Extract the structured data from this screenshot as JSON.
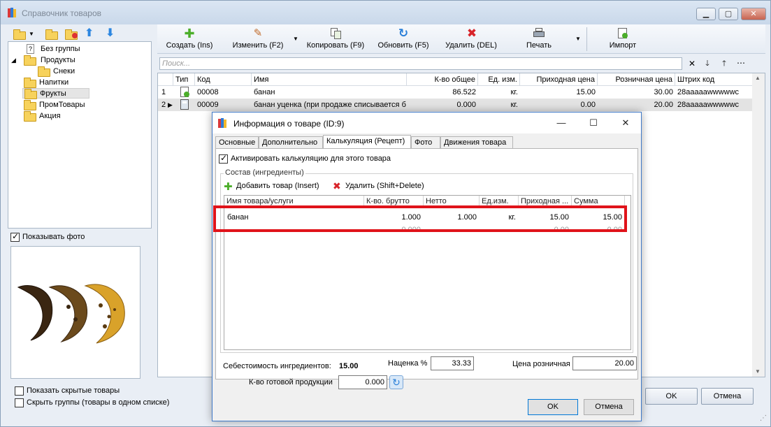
{
  "main_window": {
    "title": "Справочник товаров",
    "controls": [
      "▭",
      "▢",
      "✕"
    ]
  },
  "tree": {
    "items": [
      {
        "label": "Без группы",
        "level": 1
      },
      {
        "label": "Продукты",
        "level": 1
      },
      {
        "label": "Снеки",
        "level": 2
      },
      {
        "label": "Напитки",
        "level": 1
      },
      {
        "label": "Фрукты",
        "level": 1,
        "selected": true
      },
      {
        "label": "ПромТовары",
        "level": 1
      },
      {
        "label": "Акция",
        "level": 1
      }
    ]
  },
  "photo": {
    "show_label": "Показывать фото",
    "checked": true
  },
  "toolbar": {
    "create": "Создать (Ins)",
    "edit": "Изменить (F2)",
    "copy": "Копировать (F9)",
    "refresh": "Обновить (F5)",
    "delete": "Удалить (DEL)",
    "print": "Печать",
    "import": "Импорт"
  },
  "search": {
    "placeholder": "Поиск..."
  },
  "grid": {
    "columns": [
      "Тип",
      "Код",
      "Имя",
      "К-во общее",
      "Ед. изм.",
      "Приходная цена",
      "Розничная цена",
      "Штрих код"
    ],
    "rows": [
      {
        "num": "1",
        "code": "00008",
        "name": "банан",
        "qty": "86.522",
        "unit": "кг.",
        "in_price": "15.00",
        "retail": "30.00",
        "barcode": "28aaaaawwwwwc"
      },
      {
        "num": "2",
        "code": "00009",
        "name": "банан уценка (при продаже списывается б",
        "qty": "0.000",
        "unit": "кг.",
        "in_price": "0.00",
        "retail": "20.00",
        "barcode": "28aaaaawwwwwc"
      }
    ]
  },
  "bottom": {
    "show_hidden": "Показать скрытые товары",
    "hide_groups": "Скрыть группы (товары в одном списке)",
    "ok": "OK",
    "cancel": "Отмена"
  },
  "dialog": {
    "title": "Информация о товаре (ID:9)",
    "tabs": [
      "Основные",
      "Дополнительно",
      "Калькуляция (Рецепт)",
      "Фото",
      "Движения товара"
    ],
    "active_tab": 2,
    "activate_label": "Активировать калькуляцию для этого товара",
    "activate_checked": true,
    "composition_label": "Состав (ингредиенты)",
    "add_label": "Добавить товар (Insert)",
    "remove_label": "Удалить (Shift+Delete)",
    "ing_columns": [
      "Имя товара/услуги",
      "К-во. брутто",
      "Нетто",
      "Ед.изм.",
      "Приходная ...",
      "Сумма"
    ],
    "ing_rows": [
      {
        "name": "банан",
        "brutto": "1.000",
        "netto": "1.000",
        "unit": "кг.",
        "price": "15.00",
        "sum": "15.00"
      }
    ],
    "footer_row": {
      "brutto": "0.000",
      "price": "0.00",
      "sum": "0.00"
    },
    "cost_label": "Себестоимость ингредиентов:",
    "cost_value": "15.00",
    "markup_label": "Наценка %",
    "markup_value": "33.33",
    "retail_label": "Цена розничная",
    "retail_value": "20.00",
    "yield_label": "К-во готовой продукции",
    "yield_value": "0.000",
    "ok": "OK",
    "cancel": "Отмена"
  }
}
